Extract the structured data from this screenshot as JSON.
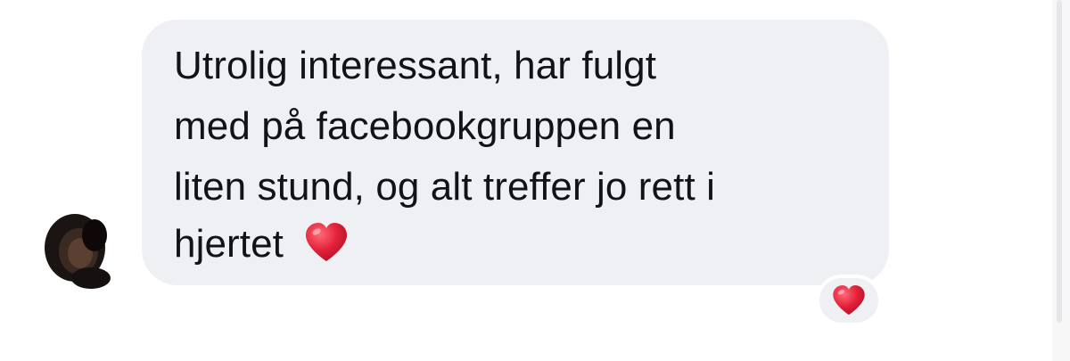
{
  "message": {
    "lines": [
      "Utrolig interessant, har fulgt",
      "med på facebookgruppen en",
      "liten stund, og alt treffer jo rett i",
      "hjertet"
    ],
    "inline_emoji": "heart-icon",
    "reaction": "heart-icon"
  },
  "colors": {
    "bubble": "#eef0f3",
    "text": "#111318",
    "heart": "#e3213a"
  }
}
